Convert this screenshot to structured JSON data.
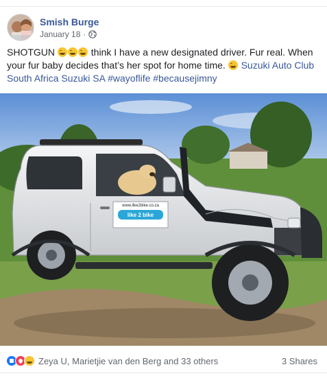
{
  "post": {
    "author": "Smish Burge",
    "date": "January 18",
    "date_separator": "·",
    "privacy_icon": "globe-icon",
    "text": {
      "line1_a": "SHOTGUN",
      "line1_b": "think I have a new designated driver. Fur real.",
      "line2_a": "When your fur baby decides that’s her spot for home time.",
      "link1": "Suzuki",
      "link2": "Auto Club South Africa",
      "link3": "Suzuki SA",
      "hashtag1": "#wayoflife",
      "hashtag2": "#becausejimny"
    },
    "emoji_name": "rolling-on-floor-laughing",
    "vehicle_decal": {
      "url": "www.like2bike.co.za",
      "brand": "like 2 bike"
    }
  },
  "footer": {
    "reaction_icons": [
      "like-icon",
      "love-icon",
      "haha-icon"
    ],
    "reaction_summary": "Zeya U, Marietjie van den Berg and 33 others",
    "shares": "3 Shares"
  },
  "colors": {
    "link": "#385898",
    "text": "#1c1e21",
    "meta": "#606770",
    "like": "#1877f2",
    "love": "#f33e58",
    "haha": "#f7c531"
  }
}
